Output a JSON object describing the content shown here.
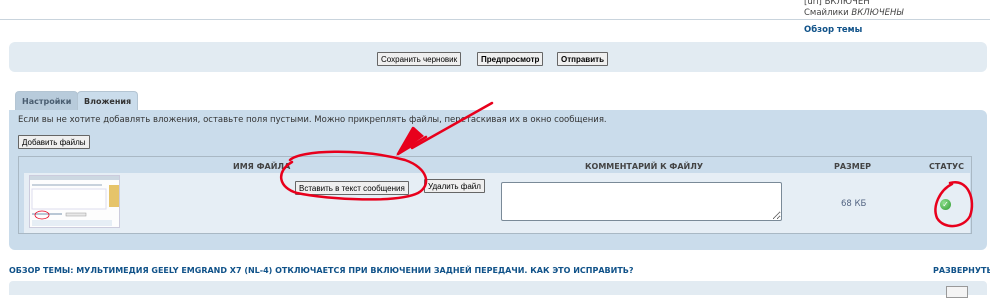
{
  "header": {
    "bbcode_status": "[url] ВКЛЮЧЕН",
    "smilies_status_prefix": "Смайлики ",
    "smilies_status_value": "ВКЛЮЧЕНЫ",
    "topic_review_link": "Обзор темы"
  },
  "submit_buttons": {
    "save_draft": "Сохранить черновик",
    "preview": "Предпросмотр",
    "submit": "Отправить"
  },
  "tabs": [
    {
      "label": "Настройки",
      "active": false
    },
    {
      "label": "Вложения",
      "active": true
    }
  ],
  "attachments": {
    "notice": "Если вы не хотите добавлять вложения, оставьте поля пустыми. Можно прикреплять файлы, перетаскивая их в окно сообщения.",
    "add_files_label": "Добавить файлы",
    "columns": {
      "filename": "ИМЯ ФАЙЛА",
      "comment": "КОММЕНТАРИЙ К ФАЙЛУ",
      "size": "РАЗМЕР",
      "status": "СТАТУС"
    },
    "rows": [
      {
        "insert_label": "Вставить в текст сообщения",
        "delete_label": "Удалить файл",
        "comment": "",
        "size": "68 КБ",
        "status_icon": "checkmark-icon"
      }
    ]
  },
  "topic_review": {
    "title": "ОБЗОР ТЕМЫ: МУЛЬТИМЕДИЯ GEELY EMGRAND X7 (NL-4) ОТКЛЮЧАЕТСЯ ПРИ ВКЛЮЧЕНИИ ЗАДНЕЙ ПЕРЕДАЧИ. КАК ЭТО ИСПРАВИТЬ?",
    "expand_label": "РАЗВЕРНУТЬ"
  },
  "annotation_color": "#e8001c"
}
